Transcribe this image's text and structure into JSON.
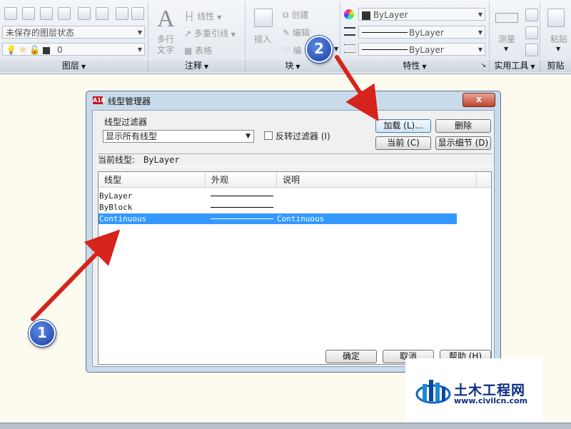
{
  "ribbon": {
    "layers_panel": {
      "title": "图层",
      "layer_state_value": "未保存的图层状态",
      "layer_value": "0"
    },
    "annotation_panel": {
      "title": "注释",
      "multiline_text_label": "多行文字",
      "linear_label": "线性",
      "multileader_label": "多重引线",
      "table_label": "表格"
    },
    "block_panel": {
      "title": "块",
      "insert_label": "插入",
      "create_label": "创建",
      "edit_label": "编辑",
      "attribute_label": "编"
    },
    "properties_panel": {
      "title": "特性",
      "color_value": "ByLayer",
      "linetype_value": "ByLayer",
      "lineweight_value": "ByLayer"
    },
    "utilities_panel": {
      "title": "实用工具",
      "measure_label": "测量"
    },
    "clipboard_panel": {
      "title": "剪贴",
      "paste_label": "粘贴"
    }
  },
  "dialog": {
    "title": "线型管理器",
    "app_icon_text": "A10",
    "close_label": "x",
    "filter": {
      "group_label": "线型过滤器",
      "selected": "显示所有线型",
      "invert_label": "反转过滤器 (I)",
      "invert_checked": false
    },
    "buttons": {
      "load": "加载 (L)...",
      "delete": "删除",
      "current": "当前 (C)",
      "show_details": "显示细节 (D)",
      "ok": "确定",
      "cancel": "取消",
      "help": "帮助 (H)"
    },
    "current_linetype": {
      "label": "当前线型:",
      "value": "ByLayer"
    },
    "table": {
      "columns": [
        "线型",
        "外观",
        "说明"
      ],
      "rows": [
        {
          "linetype": "ByLayer",
          "description": "",
          "selected": false
        },
        {
          "linetype": "ByBlock",
          "description": "",
          "selected": false
        },
        {
          "linetype": "Continuous",
          "description": "Continuous",
          "selected": true
        }
      ]
    }
  },
  "annotations": {
    "badge_1": "1",
    "badge_2": "2",
    "arrow_color": "#d6231c"
  },
  "watermark": {
    "title": "土木工程网",
    "url": "www.civilcn.com"
  }
}
